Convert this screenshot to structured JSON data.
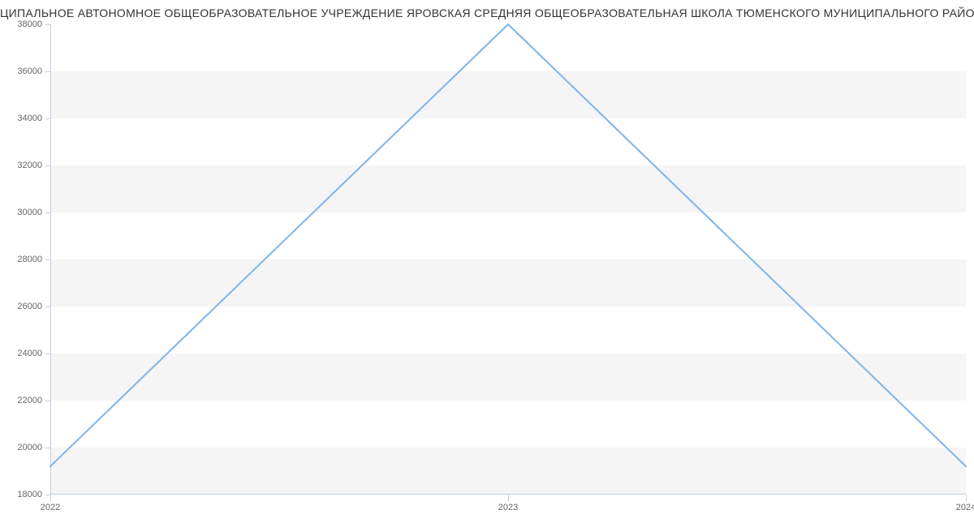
{
  "chart_data": {
    "type": "line",
    "title": "ЦИПАЛЬНОЕ АВТОНОМНОЕ ОБЩЕОБРАЗОВАТЕЛЬНОЕ УЧРЕЖДЕНИЕ ЯРОВСКАЯ СРЕДНЯЯ ОБЩЕОБРАЗОВАТЕЛЬНАЯ ШКОЛА ТЮМЕНСКОГО МУНИЦИПАЛЬНОГО РАЙОНА | Д",
    "x": [
      2022,
      2023,
      2024
    ],
    "values": [
      19200,
      38000,
      19200
    ],
    "xlabel": "",
    "ylabel": "",
    "ylim": [
      18000,
      38000
    ],
    "y_ticks": [
      18000,
      20000,
      22000,
      24000,
      26000,
      28000,
      30000,
      32000,
      34000,
      36000,
      38000
    ],
    "x_ticks": [
      2022,
      2023,
      2024
    ],
    "line_color": "#7cb5ec"
  }
}
